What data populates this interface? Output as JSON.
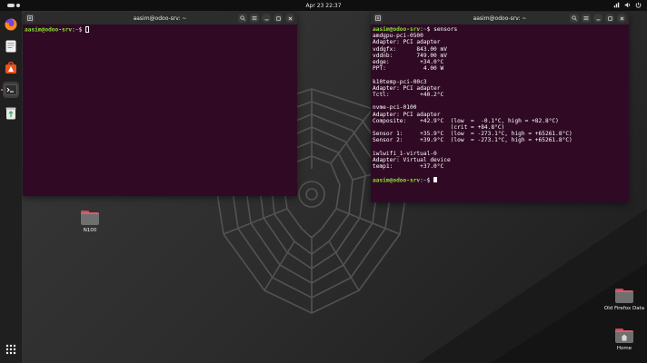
{
  "topbar": {
    "clock": "Apr 23  22:37"
  },
  "dock": {
    "items": [
      {
        "name": "firefox",
        "icon": "firefox-icon"
      },
      {
        "name": "text-editor",
        "icon": "text-editor-icon"
      },
      {
        "name": "app-center",
        "icon": "app-center-icon"
      },
      {
        "name": "terminal",
        "icon": "terminal-icon",
        "active": true
      },
      {
        "name": "trash",
        "icon": "trash-icon"
      }
    ],
    "apps_grid_icon": "apps-grid-icon"
  },
  "colors": {
    "terminal_bg": "#300a24",
    "prompt_user": "#8ae234",
    "prompt_path": "#729fcf",
    "accent_dot": "#f07d3a"
  },
  "terminal_left": {
    "title": "aasim@odoo-srv: ~",
    "prompt_user": "aasim@odoo-srv",
    "prompt_path": "~",
    "prompt_symbol": "$"
  },
  "terminal_right": {
    "title": "aasim@odoo-srv: ~",
    "prompt_user": "aasim@odoo-srv",
    "prompt_path": "~",
    "prompt_symbol": "$",
    "command": "sensors",
    "output": [
      "amdgpu-pci-0500",
      "Adapter: PCI adapter",
      "vddgfx:      843.00 mV",
      "vddnb:       749.00 mV",
      "edge:         +34.0°C",
      "PPT:           4.00 W",
      "",
      "k10temp-pci-00c3",
      "Adapter: PCI adapter",
      "Tctl:         +40.2°C",
      "",
      "nvme-pci-0100",
      "Adapter: PCI adapter",
      "Composite:    +42.9°C  (low  =  -0.1°C, high = +82.8°C)",
      "                       (crit = +84.8°C)",
      "Sensor 1:     +35.9°C  (low  = -273.1°C, high = +65261.8°C)",
      "Sensor 2:     +39.9°C  (low  = -273.1°C, high = +65261.8°C)",
      "",
      "iwlwifi_1-virtual-0",
      "Adapter: Virtual device",
      "temp1:        +37.0°C",
      ""
    ]
  },
  "desktop": {
    "icons": [
      {
        "label": "N100"
      },
      {
        "label": "Old Firefox Data"
      },
      {
        "label": "Home"
      }
    ]
  }
}
